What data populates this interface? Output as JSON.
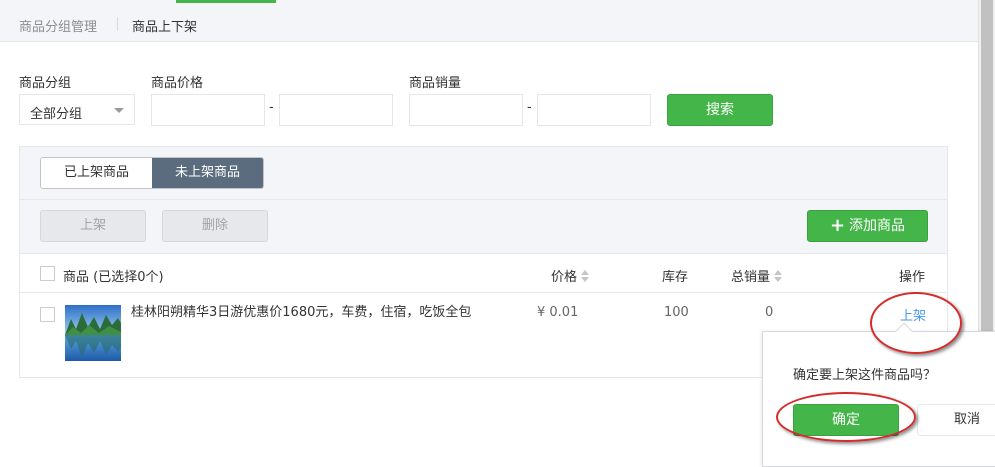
{
  "tabs": [
    "商品分组管理",
    "商品上下架"
  ],
  "filters": {
    "group_label": "商品分组",
    "group_value": "全部分组",
    "price_label": "商品价格",
    "sales_label": "商品销量",
    "range_sep": "-",
    "search_label": "搜索"
  },
  "panel": {
    "seg_on_shelf": "已上架商品",
    "seg_off_shelf": "未上架商品",
    "shelf_btn": "上架",
    "delete_btn": "删除",
    "add_btn": "添加商品",
    "add_plus": "+"
  },
  "table": {
    "col_product": "商品 (已选择0个)",
    "col_price": "价格",
    "col_stock": "库存",
    "col_sales": "总销量",
    "col_action": "操作"
  },
  "row": {
    "name": "桂林阳朔精华3日游优惠价1680元，车费，住宿，吃饭全包",
    "price": "¥ 0.01",
    "stock": "100",
    "sales": "0",
    "action": "上架"
  },
  "popover": {
    "message": "确定要上架这件商品吗？",
    "confirm": "确定",
    "cancel": "取消"
  },
  "colors": {
    "accent_green": "#44b549",
    "link_blue": "#459ae9",
    "annotation_red": "#d42b2b"
  }
}
